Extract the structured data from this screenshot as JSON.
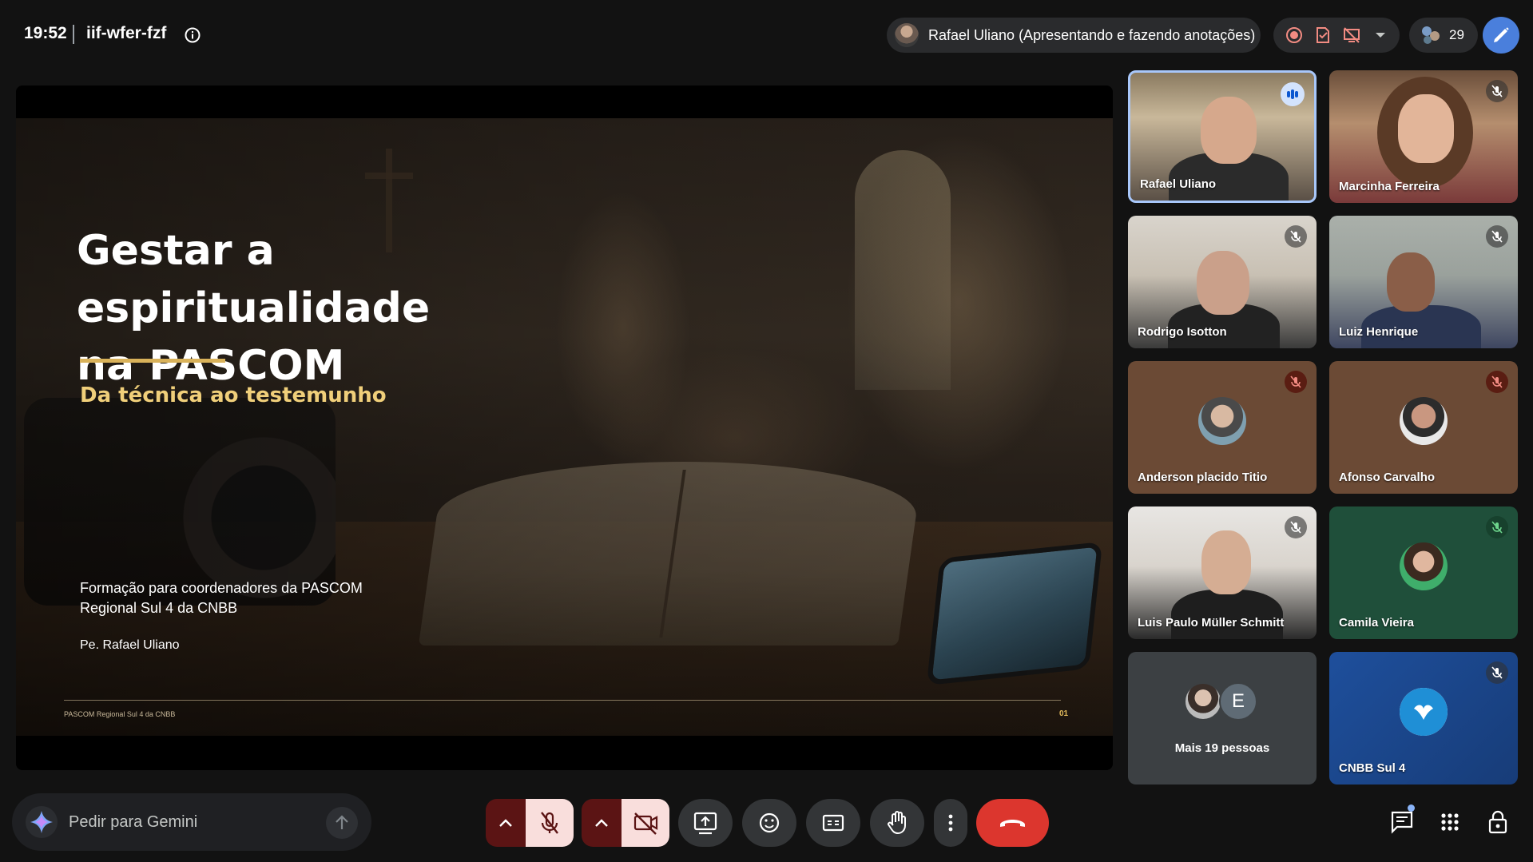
{
  "header": {
    "time": "19:52",
    "meeting_code": "iif-wfer-fzf",
    "presenter_status": "Rafael Uliano (Apresentando e fazendo anotações)",
    "participant_count": "29"
  },
  "slide": {
    "title_line1": "Gestar a espiritualidade",
    "title_line2": "na PASCOM",
    "subtitle": "Da técnica ao testemunho",
    "line1": "Formação para coordenadores da PASCOM",
    "line2": "Regional Sul 4 da CNBB",
    "author": "Pe. Rafael Uliano",
    "footer_left": "PASCOM Regional Sul 4 da CNBB",
    "page_number": "01",
    "accent_color": "#d9b25a"
  },
  "participants": [
    {
      "name": "Rafael Uliano",
      "state": "speaking"
    },
    {
      "name": "Marcinha Ferreira",
      "state": "muted"
    },
    {
      "name": "Rodrigo Isotton",
      "state": "muted"
    },
    {
      "name": "Luiz Henrique",
      "state": "muted"
    },
    {
      "name": "Anderson placido Titio",
      "state": "muted"
    },
    {
      "name": "Afonso Carvalho",
      "state": "muted"
    },
    {
      "name": "Luis Paulo Müller Schmitt",
      "state": "muted"
    },
    {
      "name": "Camila Vieira",
      "state": "muted"
    },
    {
      "name": "Mais 19 pessoas",
      "avatar_letter": "E"
    },
    {
      "name": "CNBB Sul 4",
      "state": "muted"
    }
  ],
  "gemini": {
    "placeholder": "Pedir para Gemini"
  },
  "controls": {
    "mic": "muted",
    "camera": "off",
    "hangup_color": "#dc362e"
  }
}
